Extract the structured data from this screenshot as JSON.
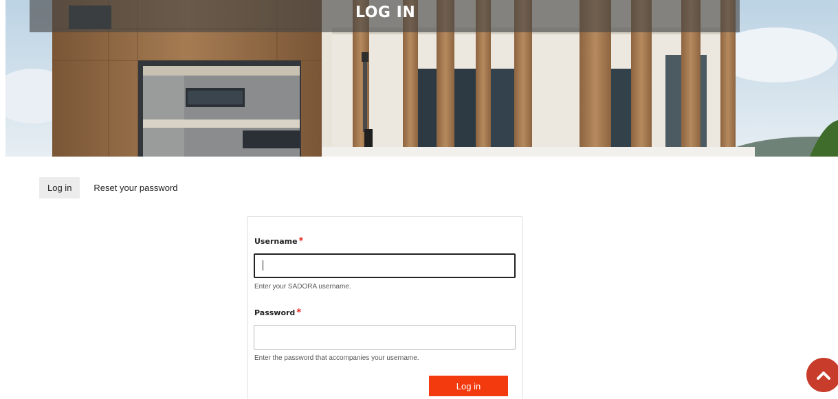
{
  "header": {
    "page_title": "LOG IN"
  },
  "tabs": [
    {
      "label": "Log in",
      "active": true
    },
    {
      "label": "Reset your password",
      "active": false
    }
  ],
  "form": {
    "username": {
      "label": "Username",
      "required_mark": "*",
      "value": "",
      "help": "Enter your SADORA username."
    },
    "password": {
      "label": "Password",
      "required_mark": "*",
      "value": "",
      "help": "Enter the password that accompanies your username."
    },
    "submit_label": "Log in"
  },
  "icons": {
    "back_to_top": "chevron-up-icon"
  },
  "colors": {
    "accent": "#f23a0e",
    "required": "#e4251a",
    "back_to_top": "#c83c2b"
  }
}
